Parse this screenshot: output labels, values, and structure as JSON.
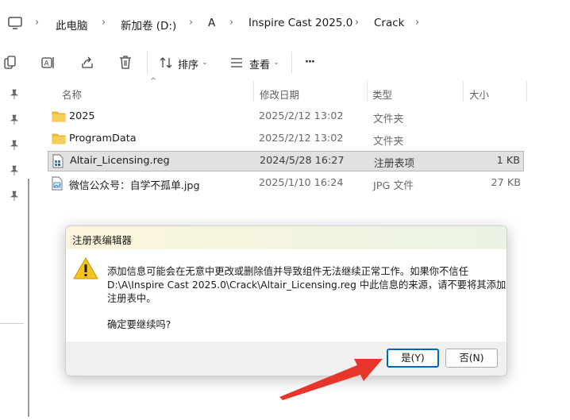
{
  "address": {
    "crumbs": [
      "此电脑",
      "新加卷 (D:)",
      "A",
      "Inspire Cast 2025.0",
      "Crack"
    ]
  },
  "toolbar": {
    "sort_label": "排序",
    "view_label": "查看",
    "more_label": "···"
  },
  "columns": {
    "name": "名称",
    "date": "修改日期",
    "type": "类型",
    "size": "大小"
  },
  "files": [
    {
      "name": "2025",
      "date": "2025/2/12 13:02",
      "type": "文件夹",
      "size": "",
      "icon": "folder-icon"
    },
    {
      "name": "ProgramData",
      "date": "2025/2/12 13:02",
      "type": "文件夹",
      "size": "",
      "icon": "folder-icon"
    },
    {
      "name": "Altair_Licensing.reg",
      "date": "2024/5/28 16:27",
      "type": "注册表项",
      "size": "1 KB",
      "icon": "registry-file-icon",
      "selected": true
    },
    {
      "name": "微信公众号：自学不孤单.jpg",
      "date": "2025/1/10 16:24",
      "type": "JPG 文件",
      "size": "27 KB",
      "icon": "image-file-icon"
    }
  ],
  "dialog": {
    "title": "注册表编辑器",
    "line1": "添加信息可能会在无意中更改或删除值并导致组件无法继续正常工作。如果你不信任",
    "line2": "D:\\A\\Inspire Cast 2025.0\\Crack\\Altair_Licensing.reg 中此信息的来源，请不要将其添加到",
    "line3": "注册表中。",
    "question": "确定要继续吗?",
    "yes_label": "是(Y)",
    "no_label": "否(N)"
  },
  "colors": {
    "accent": "#0067c0",
    "arrow": "#e8352b",
    "folder": "#f4c037",
    "warning": "#f7c31f"
  }
}
